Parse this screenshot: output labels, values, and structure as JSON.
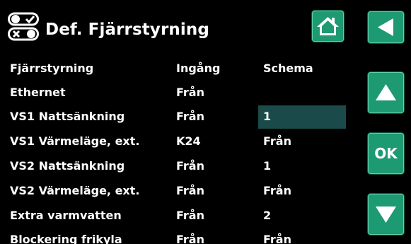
{
  "header": {
    "title": "Def. Fjärrstyrning",
    "title_icon": "toggle-switches-icon",
    "home_icon": "home-icon",
    "back_icon": "back-arrow-icon"
  },
  "columns": {
    "col1": "Fjärrstyrning",
    "col2": "Ingång",
    "col3": "Schema"
  },
  "rows": [
    {
      "name": "Ethernet",
      "input": "Från",
      "schedule": ""
    },
    {
      "name": "VS1 Nattsänkning",
      "input": "Från",
      "schedule": "1"
    },
    {
      "name": "VS1 Värmeläge, ext.",
      "input": "K24",
      "schedule": "Från"
    },
    {
      "name": "VS2 Nattsänkning",
      "input": "Från",
      "schedule": "1"
    },
    {
      "name": "VS2 Värmeläge, ext.",
      "input": "Från",
      "schedule": "Från"
    },
    {
      "name": "Extra varmvatten",
      "input": "Från",
      "schedule": "2"
    },
    {
      "name": "Blockering frikyla",
      "input": "Från",
      "schedule": "Från"
    }
  ],
  "selected_row_index": 1,
  "nav": {
    "up_icon": "up-arrow-icon",
    "ok_label": "OK",
    "down_icon": "down-arrow-icon"
  },
  "colors": {
    "background": "#000000",
    "button": "#1e9a72",
    "selection": "#1a4b4a",
    "text": "#ffffff"
  }
}
